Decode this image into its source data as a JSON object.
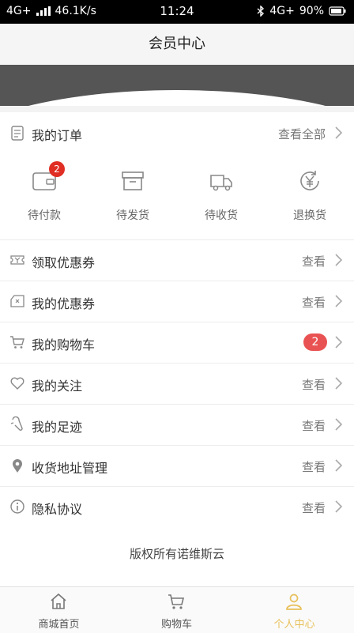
{
  "status_bar": {
    "network": "4G+",
    "speed": "46.1K/s",
    "time": "11:24",
    "network_right": "4G+",
    "battery": "90%"
  },
  "header": {
    "title": "会员中心"
  },
  "orders": {
    "title": "我的订单",
    "view_all": "查看全部",
    "items": [
      {
        "label": "待付款",
        "icon": "wallet-icon",
        "badge": "2"
      },
      {
        "label": "待发货",
        "icon": "box-icon"
      },
      {
        "label": "待收货",
        "icon": "truck-icon"
      },
      {
        "label": "退换货",
        "icon": "refund-yen-icon"
      }
    ]
  },
  "menu": [
    {
      "label": "领取优惠券",
      "right": "查看",
      "icon": "ticket-icon"
    },
    {
      "label": "我的优惠券",
      "right": "查看",
      "icon": "coupon-icon"
    },
    {
      "label": "我的购物车",
      "badge": "2",
      "icon": "cart-icon"
    },
    {
      "label": "我的关注",
      "right": "查看",
      "icon": "heart-icon"
    },
    {
      "label": "我的足迹",
      "right": "查看",
      "icon": "footprint-icon"
    },
    {
      "label": "收货地址管理",
      "right": "查看",
      "icon": "location-icon"
    },
    {
      "label": "隐私协议",
      "right": "查看",
      "icon": "info-icon"
    }
  ],
  "footer": {
    "copyright": "版权所有诺维斯云"
  },
  "tabbar": {
    "items": [
      {
        "label": "商城首页",
        "icon": "home-icon"
      },
      {
        "label": "购物车",
        "icon": "cart-icon"
      },
      {
        "label": "个人中心",
        "icon": "user-icon",
        "active": true
      }
    ]
  },
  "colors": {
    "accent": "#e8c05a",
    "badge": "#e02e24",
    "banner": "#555555"
  }
}
